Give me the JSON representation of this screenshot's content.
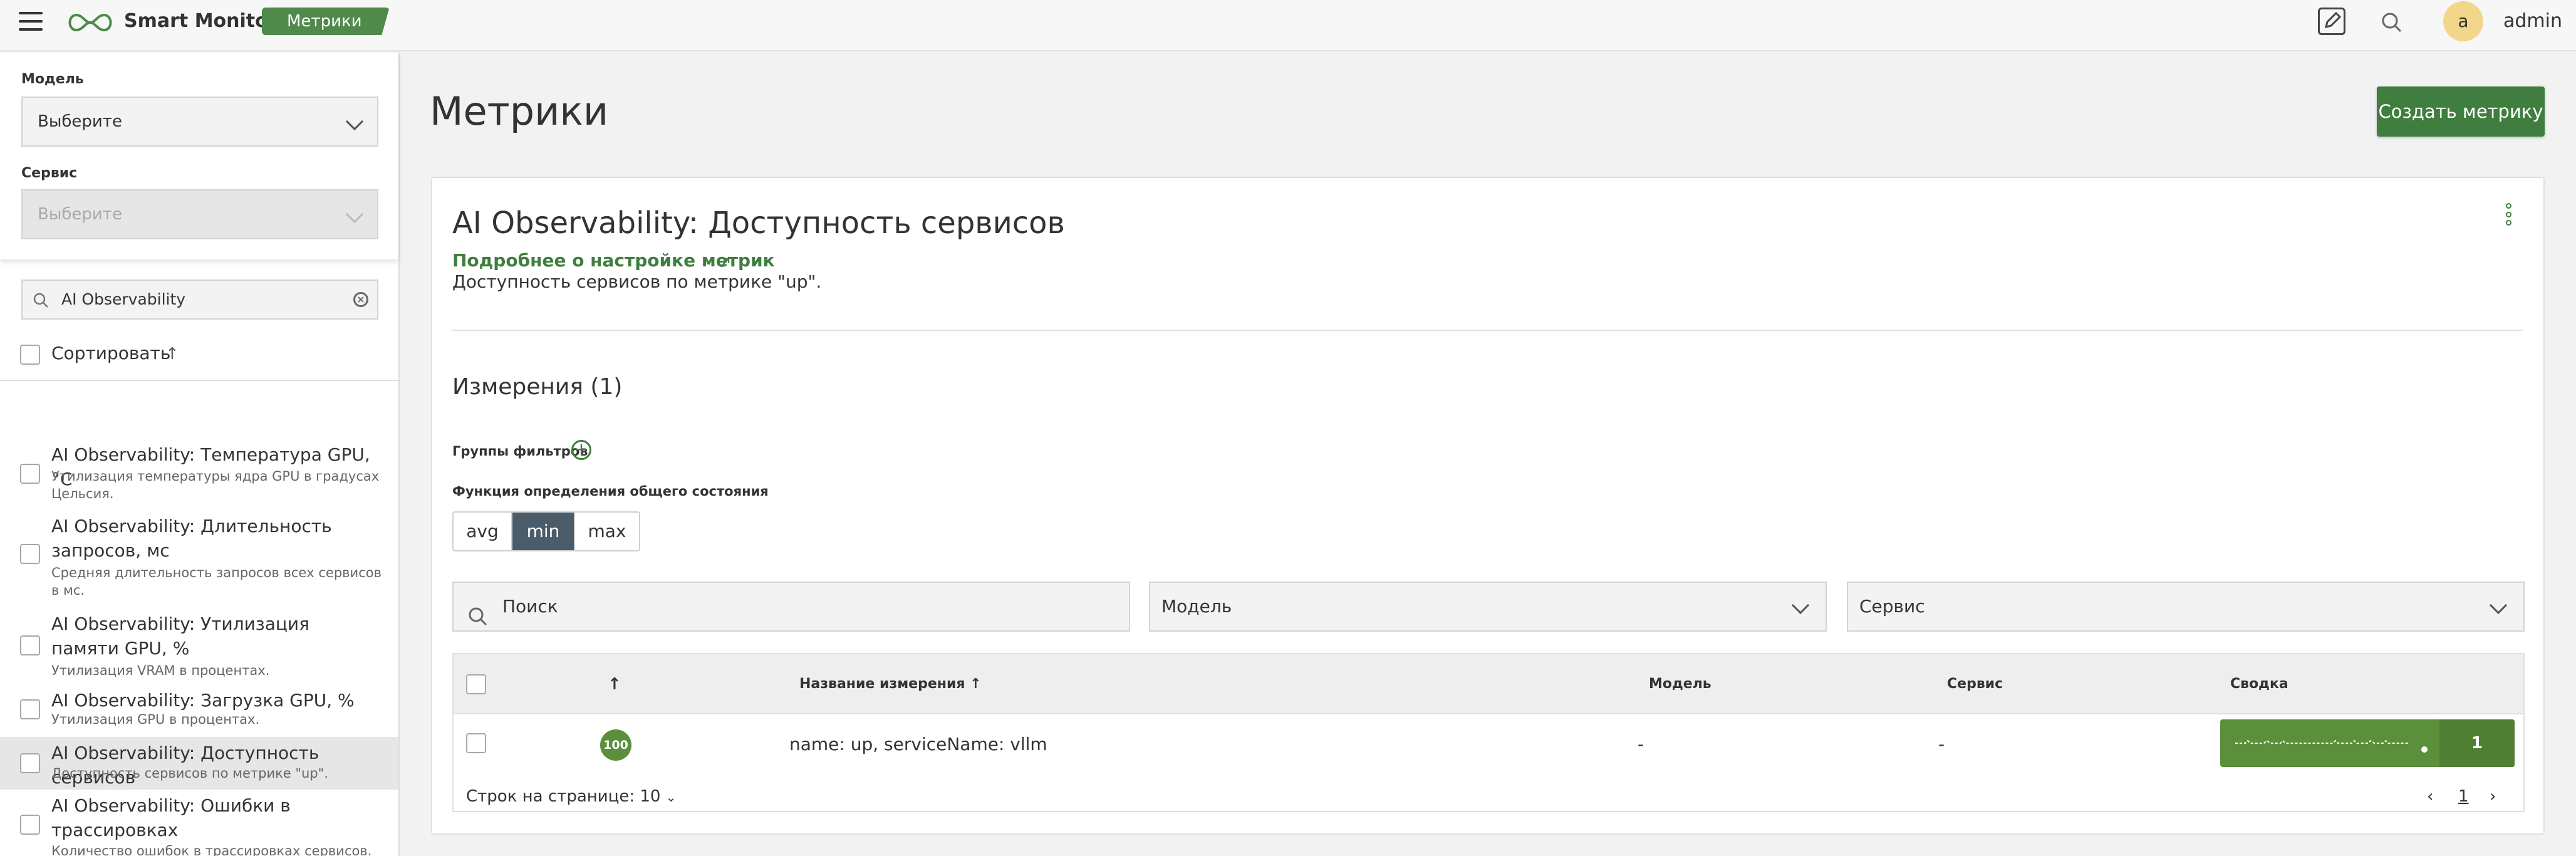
{
  "header": {
    "brand": "Smart Monitor",
    "section_badge": "Метрики",
    "user_avatar_letter": "a",
    "username": "admin"
  },
  "sidebar": {
    "model_label": "Модель",
    "model_value": "Выберите",
    "service_label": "Сервис",
    "service_value": "Выберите",
    "search_value": "AI Observability",
    "sort_label": "Сортировать",
    "items": [
      {
        "title": "AI Observability: Температура GPU, °C",
        "desc": "Утилизация температуры ядра GPU в градусах Цельсия."
      },
      {
        "title": "AI Observability: Длительность запросов, мс",
        "desc": "Средняя длительность запросов всех сервисов в мс."
      },
      {
        "title": "AI Observability: Утилизация памяти GPU, %",
        "desc": "Утилизация VRAM в процентах."
      },
      {
        "title": "AI Observability: Загрузка GPU, %",
        "desc": "Утилизация GPU в процентах."
      },
      {
        "title": "AI Observability: Доступность сервисов",
        "desc": "Доступность сервисов по метрике \"up\"."
      },
      {
        "title": "AI Observability: Ошибки в трассировках",
        "desc": "Количество ошибок в трассировках сервисов."
      }
    ],
    "active_index": 4
  },
  "main": {
    "page_title": "Метрики",
    "create_button": "Создать метрику",
    "metric_title": "AI Observability: Доступность сервисов",
    "docs_link": "Подробнее о настройке метрик",
    "metric_desc": "Доступность сервисов по метрике \"up\".",
    "dimensions_title": "Измерения (1)",
    "filter_groups_label": "Группы фильтров",
    "function_label": "Функция определения общего состояния",
    "functions": [
      "avg",
      "min",
      "max"
    ],
    "selected_function": "min",
    "search_placeholder": "Поиск",
    "model_filter": "Модель",
    "service_filter": "Сервис",
    "table": {
      "columns": {
        "name": "Название измерения",
        "model": "Модель",
        "service": "Сервис",
        "summary": "Сводка"
      },
      "rows": [
        {
          "score": "100",
          "name": "name: up, serviceName: vllm",
          "model": "-",
          "service": "-",
          "summary_count": "1"
        }
      ]
    },
    "rows_per_page": "Строк на странице: 10",
    "current_page": "1"
  },
  "colors": {
    "brand_green": "#3f7e3e",
    "badge_green": "#4f8a4a",
    "selected_segment": "#4a5b6a",
    "status_green": "#5b8f3c"
  }
}
